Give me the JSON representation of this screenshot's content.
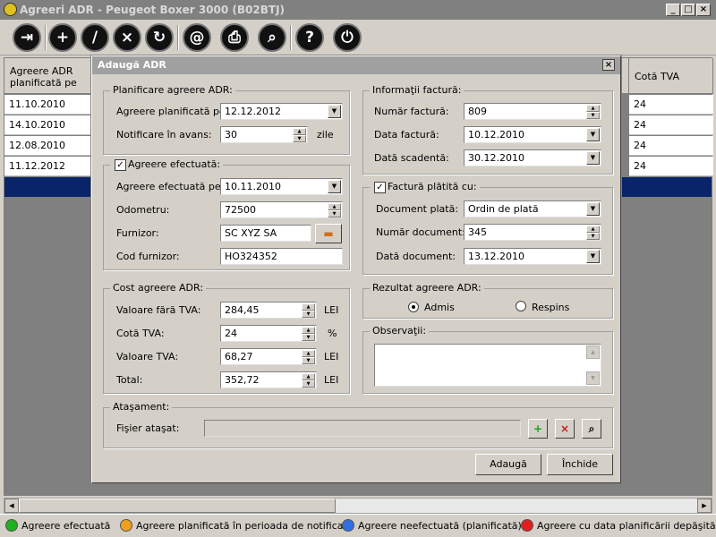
{
  "window": {
    "title": "Agreeri ADR - Peugeot Boxer 3000 (B02BTJ)",
    "min": "_",
    "max": "□",
    "close": "×"
  },
  "toolbar": {
    "exit": "⇥",
    "add": "+",
    "edit": "/",
    "delete": "×",
    "refresh": "↻",
    "email": "@",
    "print": "⎙",
    "search": "⌕",
    "help": "?",
    "power": "⏻"
  },
  "grid": {
    "col1_header": "Agreere ADR planificată pe",
    "col_last_header": "Cotă TVA",
    "rows": [
      {
        "date": "11.10.2010",
        "tva": "24"
      },
      {
        "date": "14.10.2010",
        "tva": "24"
      },
      {
        "date": "12.08.2010",
        "tva": "24"
      },
      {
        "date": "11.12.2012",
        "tva": "24"
      }
    ]
  },
  "dialog": {
    "title": "Adaugă ADR",
    "close": "×",
    "planificare": {
      "legend": "Planificare agreere ADR:",
      "planned_label": "Agreere planificată pe:",
      "planned_value": "12.12.2012",
      "notice_label": "Notificare în avans:",
      "notice_value": "30",
      "notice_unit": "zile"
    },
    "efectuata": {
      "legend": "Agreere efectuată:",
      "checked": "✓",
      "done_label": "Agreere efectuată pe:",
      "done_value": "10.11.2010",
      "odometer_label": "Odometru:",
      "odometer_value": "72500",
      "supplier_label": "Furnizor:",
      "supplier_value": "SC XYZ SA",
      "code_label": "Cod furnizor:",
      "code_value": "HO324352"
    },
    "cost": {
      "legend": "Cost agreere ADR:",
      "net_label": "Valoare fără TVA:",
      "net_value": "284,45",
      "net_unit": "LEI",
      "rate_label": "Cotă TVA:",
      "rate_value": "24",
      "rate_unit": "%",
      "vat_label": "Valoare TVA:",
      "vat_value": "68,27",
      "vat_unit": "LEI",
      "total_label": "Total:",
      "total_value": "352,72",
      "total_unit": "LEI"
    },
    "factura": {
      "legend": "Informaţii factură:",
      "num_label": "Număr factură:",
      "num_value": "809",
      "date_label": "Data factură:",
      "date_value": "10.12.2010",
      "due_label": "Dată scadentă:",
      "due_value": "30.12.2010"
    },
    "platita": {
      "legend": "Factură plătită cu:",
      "checked": "✓",
      "doc_label": "Document plată:",
      "doc_value": "Ordin de plată",
      "docnum_label": "Număr document:",
      "docnum_value": "345",
      "docdate_label": "Dată document:",
      "docdate_value": "13.12.2010"
    },
    "rezultat": {
      "legend": "Rezultat agreere ADR:",
      "admis": "Admis",
      "respins": "Respins"
    },
    "observatii": {
      "legend": "Observaţii:",
      "value": ""
    },
    "atasament": {
      "legend": "Ataşament:",
      "file_label": "Fişier ataşat:",
      "file_value": ""
    },
    "buttons": {
      "add": "Adaugă",
      "close": "Închide"
    }
  },
  "status": {
    "done": "Agreere efectuată",
    "notice": "Agreere planificată în perioada de notificare",
    "planned": "Agreere neefectuată (planificată)",
    "overdue": "Agreere cu data planificării depăşită"
  },
  "colors": {
    "green": "#20b020",
    "orange": "#f0a020",
    "blue": "#3070e0",
    "red": "#e02020",
    "selection": "#0a246a"
  }
}
